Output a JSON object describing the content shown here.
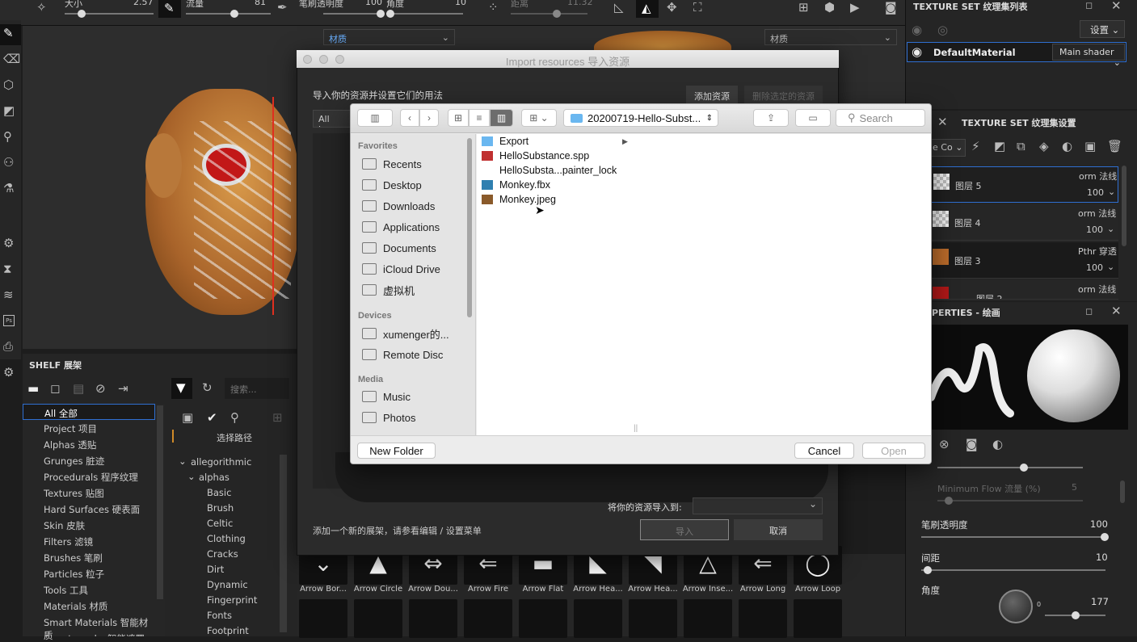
{
  "toolbar": {
    "size_label": "大小",
    "size_value": "2.57",
    "flow_label": "流量",
    "flow_value": "81",
    "opacity_label": "笔刷透明度",
    "opacity_value": "100",
    "angle_label": "角度",
    "angle_value": "10",
    "distance_label": "距离",
    "distance_value": "11.32"
  },
  "viewport": {
    "material_select_left": "材质",
    "material_select_right": "材质"
  },
  "texture_set_list": {
    "title": "TEXTURE SET 纹理集列表",
    "settings_btn": "设置",
    "material_name": "DefaultMaterial",
    "shader_select": "Main shader"
  },
  "texture_set_settings": {
    "title": "TEXTURE SET 纹理集设置",
    "blend_select": "e Co",
    "layers": [
      {
        "name": "图层 5",
        "mode": "orm 法线",
        "opacity": "100"
      },
      {
        "name": "图层 4",
        "mode": "orm 法线",
        "opacity": "100"
      },
      {
        "name": "图层 3",
        "mode": "Pthr 穿透",
        "opacity": "100"
      },
      {
        "name": "图层 2",
        "mode": "orm 法线",
        "opacity": ""
      }
    ]
  },
  "properties": {
    "title": "PERTIES - 绘画",
    "min_flow_label": "Minimum Flow 流量 (%)",
    "min_flow_value": "5",
    "opacity_label": "笔刷透明度",
    "opacity_value": "100",
    "spacing_label": "间距",
    "spacing_value": "10",
    "angle_label": "角度",
    "angle_value": "177",
    "dial_zero": "0",
    "flow_fraction": 0.7
  },
  "shelf": {
    "title": "SHELF 展架",
    "search_placeholder": "搜索...",
    "path_label": "选择路径",
    "categories": [
      "All 全部",
      "Project 项目",
      "Alphas 透贴",
      "Grunges 脏迹",
      "Procedurals 程序纹理",
      "Textures 贴图",
      "Hard Surfaces 硬表面",
      "Skin 皮肤",
      "Filters 滤镜",
      "Brushes 笔刷",
      "Particles 粒子",
      "Tools 工具",
      "Materials 材质",
      "Smart Materials 智能材质",
      "Smart masks 智能遮罩"
    ],
    "tree_root": "allegorithmic",
    "tree_group": "alphas",
    "tree_items": [
      "Basic",
      "Brush",
      "Celtic",
      "Clothing",
      "Cracks",
      "Dirt",
      "Dynamic",
      "Fingerprint",
      "Fonts",
      "Footprint"
    ],
    "brushes": [
      "Arrow Bor...",
      "Arrow Circle",
      "Arrow Dou...",
      "Arrow Fire",
      "Arrow Flat",
      "Arrow Hea...",
      "Arrow Hea...",
      "Arrow Inse...",
      "Arrow Long",
      "Arrow Loop"
    ]
  },
  "import_dialog": {
    "title": "Import resources 导入资源",
    "subtitle": "导入你的资源并设置它们的用法",
    "add_btn": "添加资源",
    "remove_btn": "删除选定的资源",
    "usage_select": "All impo",
    "import_to_label": "将你的资源导入到:",
    "hint": "添加一个新的展架，请参看编辑 / 设置菜单",
    "import_btn": "导入",
    "cancel_btn": "取消"
  },
  "file_dialog": {
    "path": "20200719-Hello-Subst...",
    "search_placeholder": "Search",
    "favorites_head": "Favorites",
    "favorites": [
      "Recents",
      "Desktop",
      "Downloads",
      "Applications",
      "Documents",
      "iCloud Drive",
      "虚拟机"
    ],
    "devices_head": "Devices",
    "devices": [
      "xumenger的...",
      "Remote Disc"
    ],
    "media_head": "Media",
    "media": [
      "Music",
      "Photos"
    ],
    "files": [
      "Export",
      "HelloSubstance.spp",
      "HelloSubsta...painter_lock",
      "Monkey.fbx",
      "Monkey.jpeg"
    ],
    "new_folder_btn": "New Folder",
    "cancel_btn": "Cancel",
    "open_btn": "Open"
  },
  "colors": {
    "accent_blue": "#4a90ff",
    "selection_red": "#e03020"
  }
}
